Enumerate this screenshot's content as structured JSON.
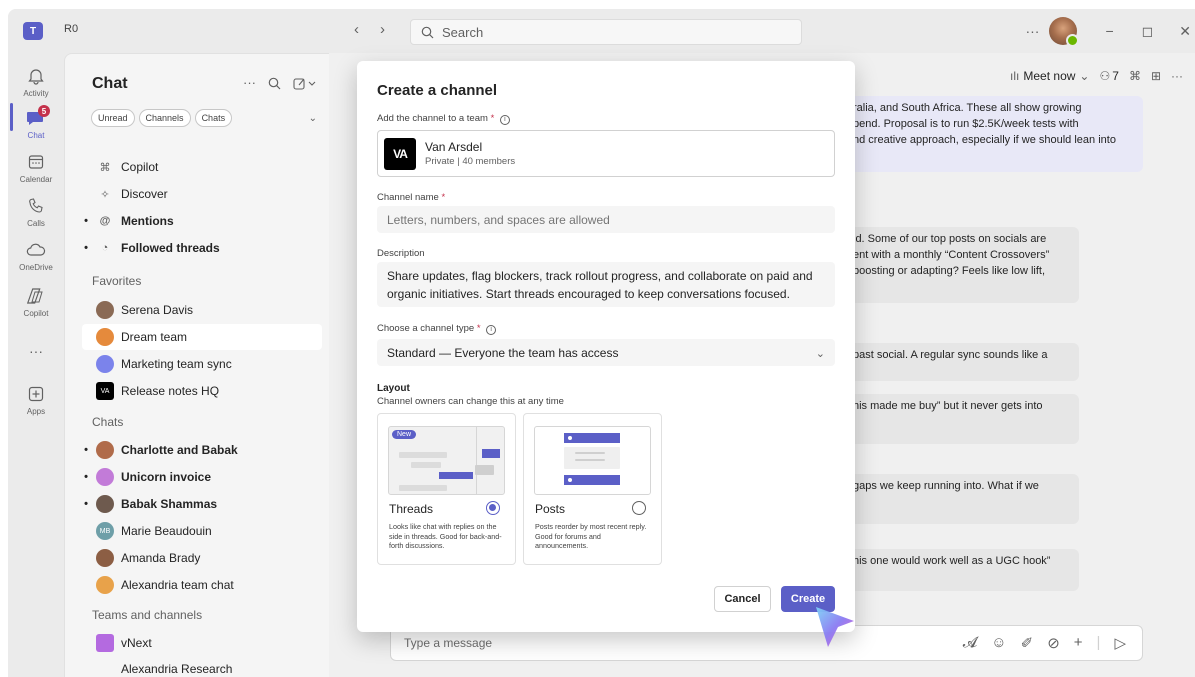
{
  "app": {
    "org_label": "R0",
    "search_placeholder": "Search",
    "more": "···",
    "minimize": "−",
    "maximize": "◻",
    "close": "✕"
  },
  "rail": [
    {
      "label": "Activity",
      "icon": "bell-icon"
    },
    {
      "label": "Chat",
      "icon": "chat-icon",
      "badge": "5"
    },
    {
      "label": "Calendar",
      "icon": "calendar-icon"
    },
    {
      "label": "Calls",
      "icon": "phone-icon"
    },
    {
      "label": "OneDrive",
      "icon": "cloud-icon"
    },
    {
      "label": "Copilot",
      "icon": "copilot-icon"
    },
    {
      "label": "···",
      "icon": "more-icon"
    },
    {
      "label": "Apps",
      "icon": "apps-icon"
    }
  ],
  "chatlist": {
    "title": "Chat",
    "filters": [
      "Unread",
      "Channels",
      "Chats"
    ],
    "items": [
      {
        "label": "Copilot",
        "bold": false,
        "dot": false
      },
      {
        "label": "Discover",
        "bold": false,
        "dot": false
      },
      {
        "label": "Mentions",
        "bold": true,
        "dot": true
      },
      {
        "label": "Followed threads",
        "bold": true,
        "dot": true
      }
    ],
    "favorites_heading": "Favorites",
    "favorites": [
      {
        "label": "Serena Davis",
        "color": "#8a6a55"
      },
      {
        "label": "Dream team",
        "color": "#e58a3c"
      },
      {
        "label": "Marketing team sync",
        "color": "#7b83eb"
      },
      {
        "label": "Release notes HQ",
        "color": "#000000"
      }
    ],
    "chats_heading": "Chats",
    "chats": [
      {
        "label": "Charlotte and Babak",
        "bold": true,
        "color": "#b06b4a"
      },
      {
        "label": "Unicorn invoice",
        "bold": true,
        "color": "#c27bd8"
      },
      {
        "label": "Babak Shammas",
        "bold": true,
        "color": "#6e5a4e"
      },
      {
        "label": "Marie Beaudouin",
        "bold": false,
        "color": "#6e9fa8",
        "initials": "MB"
      },
      {
        "label": "Amanda Brady",
        "bold": false,
        "color": "#8c5e44"
      },
      {
        "label": "Alexandria team chat",
        "bold": false,
        "color": "#e8a24a"
      }
    ],
    "teams_heading": "Teams and channels",
    "teams": [
      {
        "label": "vNext",
        "color": "#b46ae0"
      },
      {
        "label": "Alexandria Research",
        "color": ""
      }
    ]
  },
  "conversation": {
    "meet_now": "Meet now",
    "participants": "7",
    "messages": [
      "ralia, and South Africa. These all show growing",
      "pend. Proposal is to run $2.5K/week tests with",
      "nd creative approach, especially if we should lean into",
      "id. Some of our top posts on socials are",
      "ent with a monthly “Content Crossovers”",
      "boosting or adapting? Feels like low lift,",
      "past social. A regular sync sounds like a",
      "his made me buy” but it never gets into",
      "gaps we keep running into. What if we",
      "his one would work well as a UGC hook”"
    ],
    "composer_placeholder": "Type a message"
  },
  "modal": {
    "title": "Create a channel",
    "team_label": "Add the channel to a team",
    "team_required": "*",
    "team_name": "Van Arsdel",
    "team_sub": "Private | 40 members",
    "team_logo": "VA",
    "channel_name_label": "Channel name",
    "channel_name_placeholder": "Letters, numbers, and spaces are allowed",
    "description_label": "Description",
    "description_value": "Share updates, flag blockers, track rollout progress, and collaborate on paid and organic initiatives. Start threads encouraged to keep conversations focused.",
    "type_label": "Choose a channel type",
    "type_value": "Standard — Everyone the team has access",
    "layout_heading": "Layout",
    "layout_sub": "Channel owners can change this at any time",
    "layouts": [
      {
        "title": "Threads",
        "selected": true,
        "badge": "New",
        "desc": "Looks like chat with replies on the side in threads. Good for back-and-forth discussions."
      },
      {
        "title": "Posts",
        "selected": false,
        "badge": "",
        "desc": "Posts reorder by most recent reply. Good for forums and announcements."
      }
    ],
    "cancel_label": "Cancel",
    "create_label": "Create"
  },
  "colors": {
    "accent": "#5b5fc7",
    "badge": "#c4314b",
    "presence": "#6bb700"
  }
}
